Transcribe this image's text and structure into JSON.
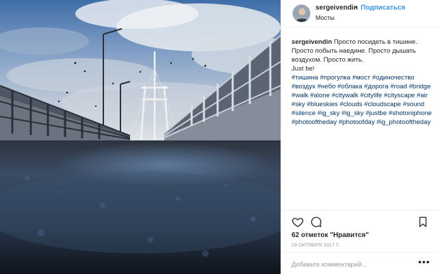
{
  "photo": {
    "alt_icon": "bridge-photo"
  },
  "post_header": {
    "username": "sergeivendin",
    "separator": "•",
    "follow_label": "Подписаться",
    "location": "Мосты"
  },
  "caption": {
    "username": "sergeivendin",
    "line1": "Просто посидеть в тишине. Просто побыть наедине. Просто дышать воздухом. Просто жить.",
    "line2": "Just be!",
    "hashtags": "#тишина #прогулка #мост #одиночество #воздух #небо #облака #дорога #road #bridge #walk #alone #citywalk #citylife #cityscape #air #sky #blueskies #clouds #cloudscape #sound #silence #ig_sky #ig_sky #justbe #shotoniphone #photooftheday #photoofday #ig_photooftheday"
  },
  "actions": {
    "like_icon": "heart-icon",
    "comment_icon": "comment-icon",
    "save_icon": "bookmark-icon"
  },
  "likes_text": "62 отметок \"Нравится\"",
  "date_text": "29 ОКТЯБРЯ 2017 Г.",
  "comment": {
    "placeholder": "Добавьте комментарий...",
    "more_label": "•••"
  },
  "colors": {
    "accent": "#3897f0",
    "hashtag": "#003569",
    "border": "#efefef"
  }
}
